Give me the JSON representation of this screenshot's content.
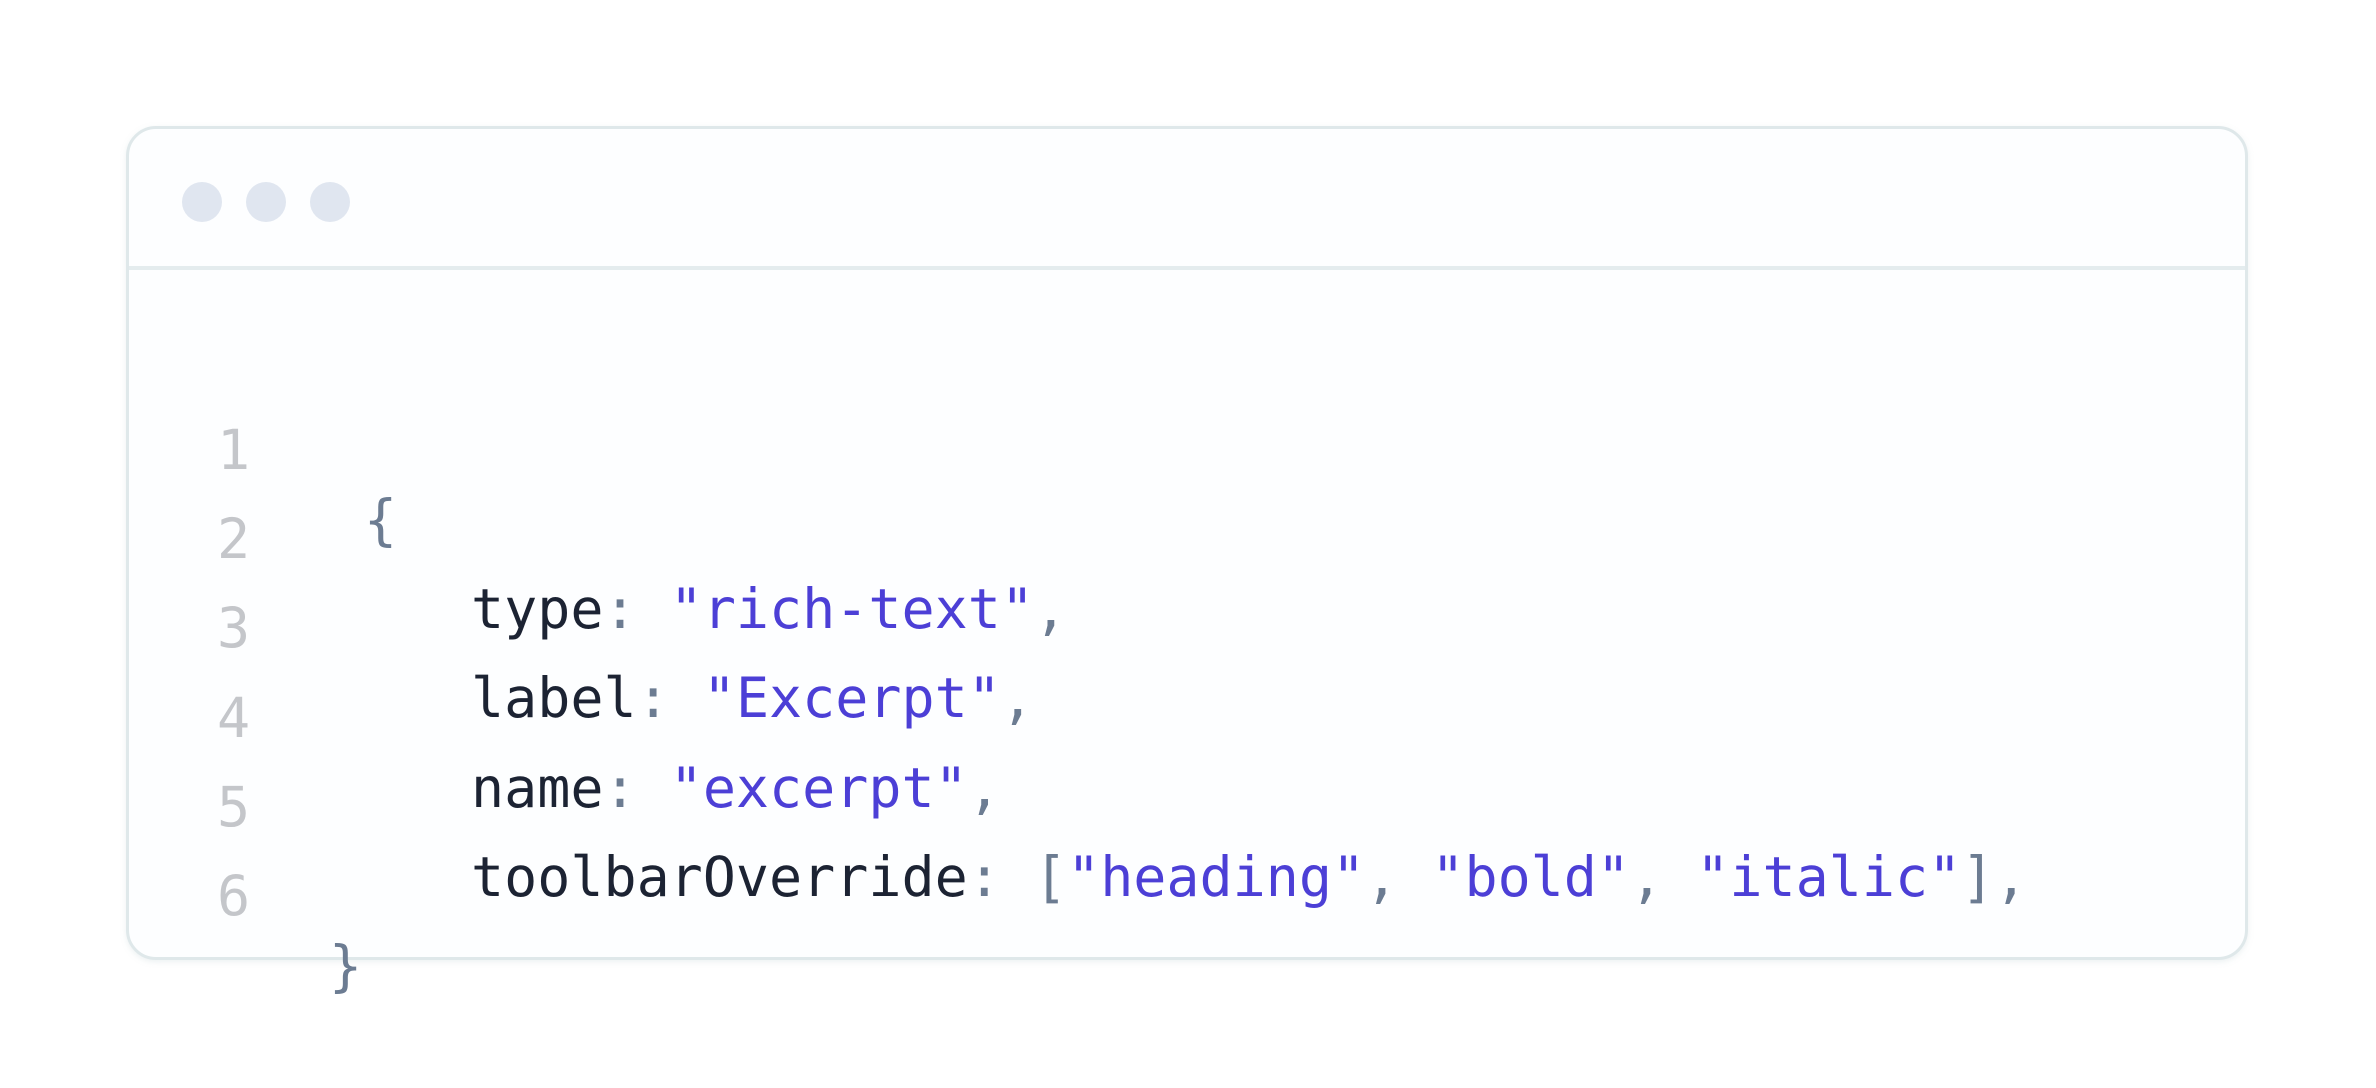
{
  "editor": {
    "window_buttons": [
      "close-dot",
      "minimize-dot",
      "maximize-dot"
    ],
    "colors": {
      "key": "#1c2333",
      "string": "#4c3fd6",
      "punctuation": "#6c7c92",
      "line_number": "#c4c6ca",
      "dot": "#e0e6f0"
    },
    "lines": [
      {
        "number": "1",
        "open_brace": "{"
      },
      {
        "number": "2",
        "key": "type",
        "colon": ":",
        "value": "\"rich-text\"",
        "comma": ","
      },
      {
        "number": "3",
        "key": "label",
        "colon": ":",
        "value": "\"Excerpt\"",
        "comma": ","
      },
      {
        "number": "4",
        "key": "name",
        "colon": ":",
        "value": "\"excerpt\"",
        "comma": ","
      },
      {
        "number": "5",
        "key": "toolbarOverride",
        "colon": ":",
        "open_bracket": "[",
        "items": [
          "\"heading\"",
          "\"bold\"",
          "\"italic\""
        ],
        "separator": ",",
        "close_bracket": "]",
        "comma": ","
      },
      {
        "number": "6",
        "close_brace": "}"
      }
    ]
  }
}
